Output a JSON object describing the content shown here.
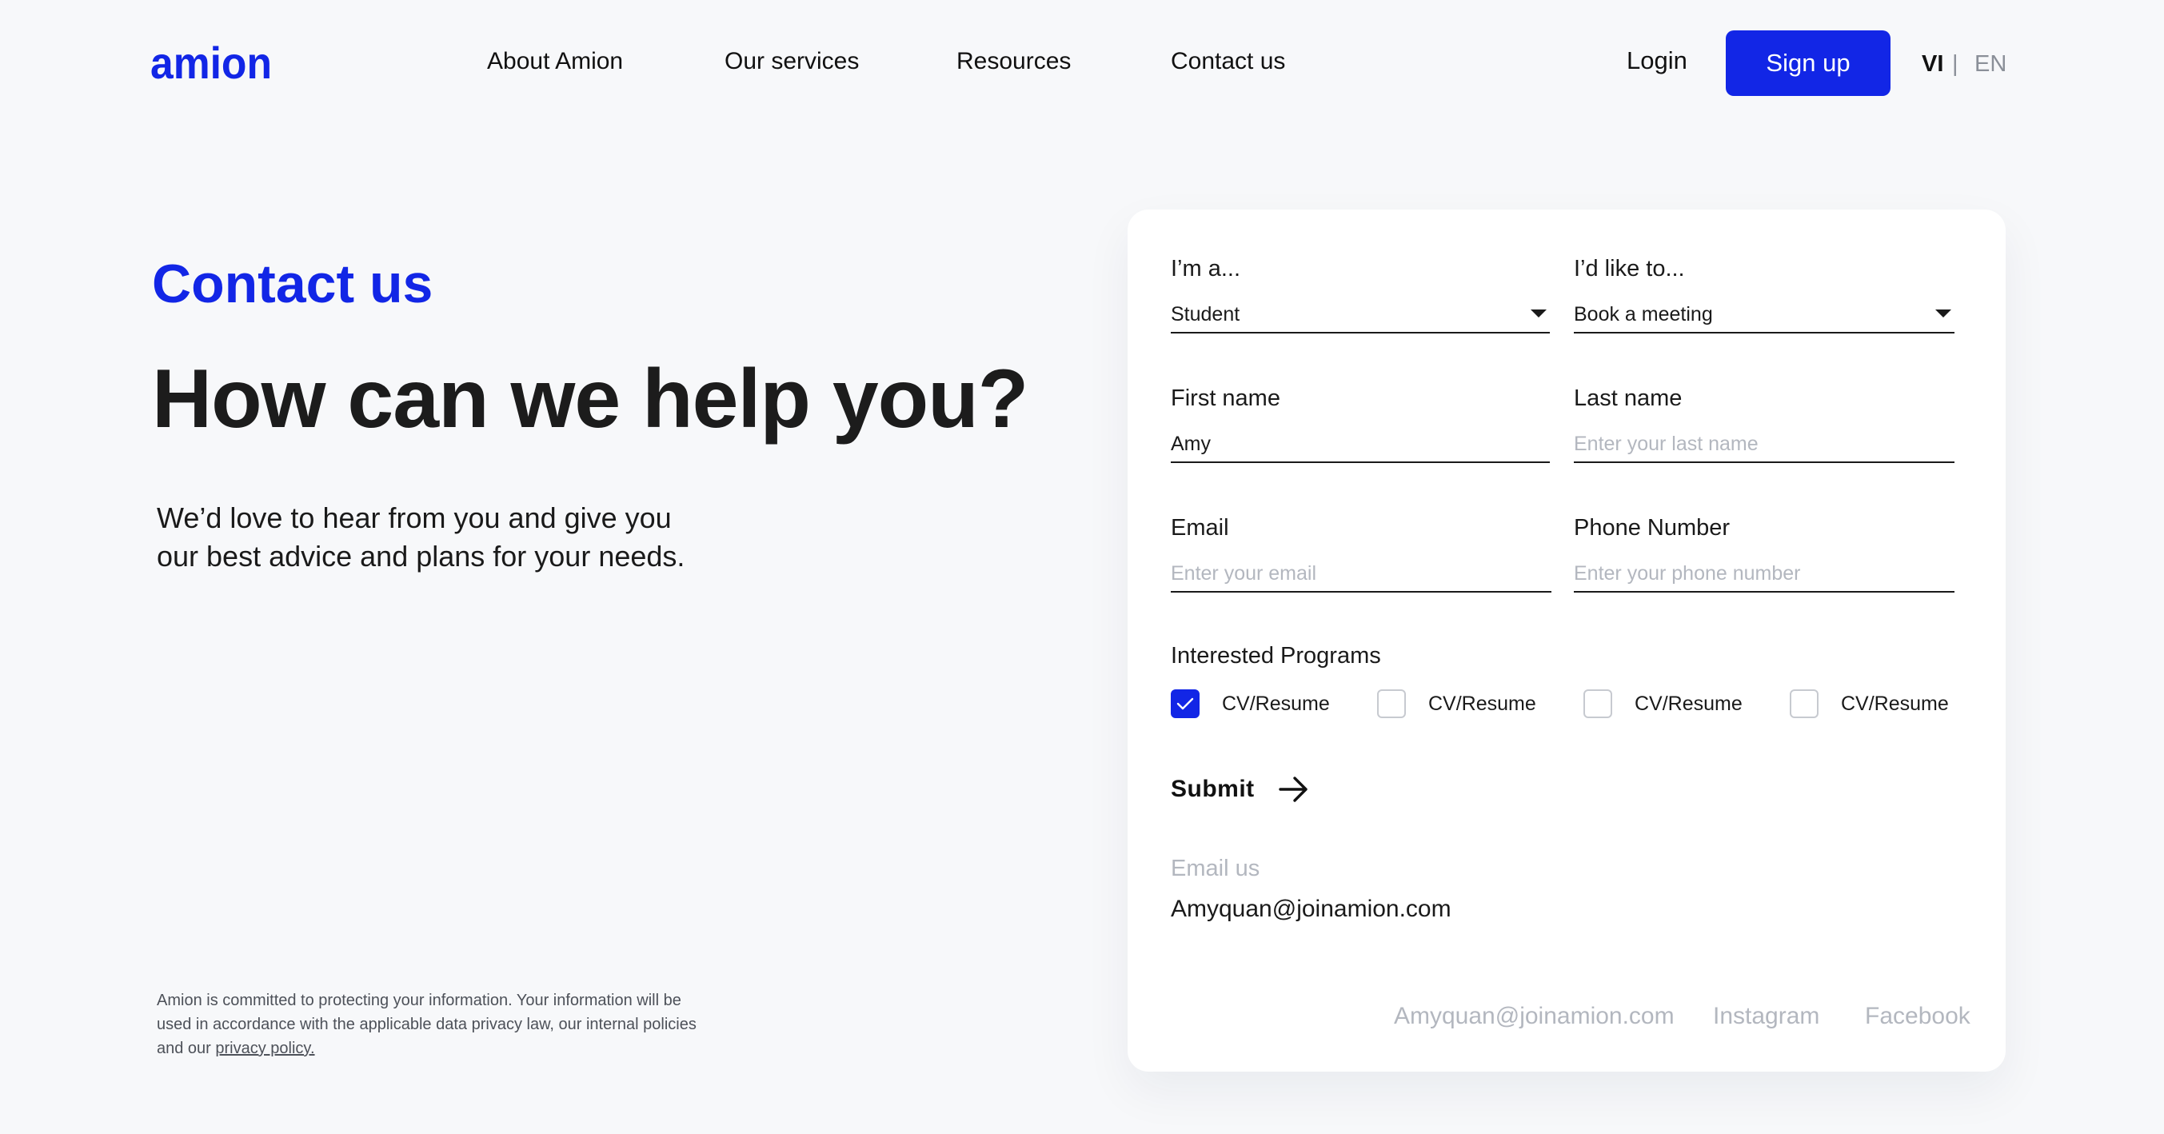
{
  "brand": {
    "logo_text": "amion",
    "accent_color": "#1226e6"
  },
  "header": {
    "nav": [
      "About Amion",
      "Our services",
      "Resources",
      "Contact us"
    ],
    "login_label": "Login",
    "signup_label": "Sign up",
    "lang_vi": "VI",
    "lang_separator": "|",
    "lang_en": "EN"
  },
  "hero": {
    "eyebrow": "Contact us",
    "headline": "How can we help you?",
    "intro_line1": "We’d love to hear from you and give you",
    "intro_line2": "our best advice and plans for your needs."
  },
  "disclaimer": {
    "text_line1": "Amion is committed to protecting your information. Your information will be",
    "text_line2": "used in accordance with the applicable data privacy law, our internal policies",
    "text_line3_prefix": "and our ",
    "policy_link": "privacy policy."
  },
  "form": {
    "role": {
      "label": "I’m a...",
      "value": "Student"
    },
    "intent": {
      "label": "I’d like to...",
      "value": "Book a meeting"
    },
    "first_name": {
      "label": "First name",
      "value": "Amy",
      "placeholder": ""
    },
    "last_name": {
      "label": "Last name",
      "value": "",
      "placeholder": "Enter your last name"
    },
    "email": {
      "label": "Email",
      "value": "",
      "placeholder": "Enter your email"
    },
    "phone": {
      "label": "Phone Number",
      "value": "",
      "placeholder": "Enter your phone number"
    },
    "programs_label": "Interested Programs",
    "programs": [
      {
        "label": "CV/Resume",
        "checked": true
      },
      {
        "label": "CV/Resume",
        "checked": false
      },
      {
        "label": "CV/Resume",
        "checked": false
      },
      {
        "label": "CV/Resume",
        "checked": false
      }
    ],
    "submit_label": "Submit",
    "email_us_label": "Email us",
    "email_us_value": "Amyquan@joinamion.com"
  },
  "card_footer": {
    "email": "Amyquan@joinamion.com",
    "instagram": "Instagram",
    "facebook": "Facebook"
  }
}
